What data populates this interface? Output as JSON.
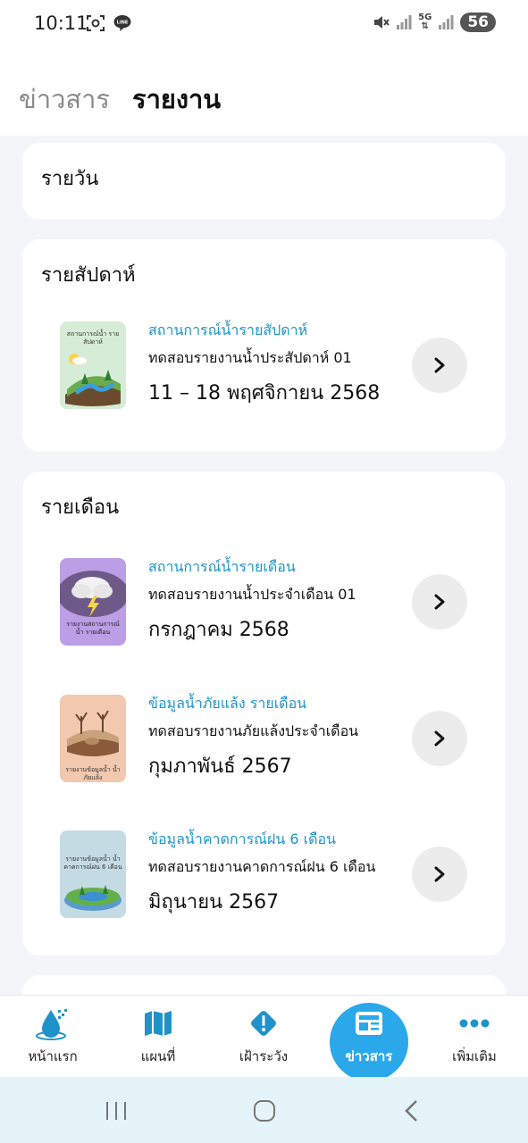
{
  "status_bar": {
    "time": "10:11",
    "network": "5G",
    "battery": "56",
    "left_icons": [
      "screenshot-icon",
      "line-app-icon"
    ],
    "right_icons": [
      "mute-icon",
      "signal-icon",
      "signal-icon"
    ]
  },
  "header": {
    "tabs": [
      {
        "label": "ข่าวสาร",
        "active": false
      },
      {
        "label": "รายงาน",
        "active": true
      }
    ]
  },
  "sections": {
    "daily": {
      "title": "รายวัน"
    },
    "weekly": {
      "title": "รายสัปดาห์",
      "items": [
        {
          "thumb_caption": "สถานการณ์น้ำ รายสัปดาห์",
          "category": "สถานการณ์น้ำรายสัปดาห์",
          "title": "ทดสอบรายงานน้ำประสัปดาห์ 01",
          "date": "11 – 18 พฤศจิกายน 2568"
        }
      ]
    },
    "monthly": {
      "title": "รายเดือน",
      "items": [
        {
          "thumb_caption": "รายงานสถานการณ์น้ำ รายเดือน",
          "category": "สถานการณ์น้ำรายเดือน",
          "title": "ทดสอบรายงานน้ำประจำเดือน 01",
          "date": "กรกฎาคม 2568"
        },
        {
          "thumb_caption": "รายงานข้อมูลน้ำ น้ำภัยแล้ง",
          "category": "ข้อมูลน้ำภัยแล้ง รายเดือน",
          "title": "ทดสอบรายงานภัยแล้งประจำเดือน",
          "date": "กุมภาพันธ์ 2567"
        },
        {
          "thumb_caption": "รายงานข้อมูลน้ำ น้ำคาดการณ์ฝน 6 เดือน",
          "category": "ข้อมูลน้ำคาดการณ์ฝน 6 เดือน",
          "title": "ทดสอบรายงานคาดการณ์ฝน 6 เดือน",
          "date": "มิถุนายน 2567"
        }
      ]
    }
  },
  "bottom_nav": {
    "items": [
      {
        "label": "หน้าแรก",
        "icon": "water-drop-icon",
        "active": false
      },
      {
        "label": "แผนที่",
        "icon": "map-icon",
        "active": false
      },
      {
        "label": "เฝ้าระวัง",
        "icon": "warning-icon",
        "active": false
      },
      {
        "label": "ข่าวสาร",
        "icon": "news-icon",
        "active": true
      },
      {
        "label": "เพิ่มเติม",
        "icon": "more-icon",
        "active": false
      }
    ]
  },
  "colors": {
    "accent": "#2aa8ea",
    "category_text": "#1f93c9",
    "content_bg": "#f3f5f8",
    "system_nav_bg": "#e4f4f8"
  }
}
